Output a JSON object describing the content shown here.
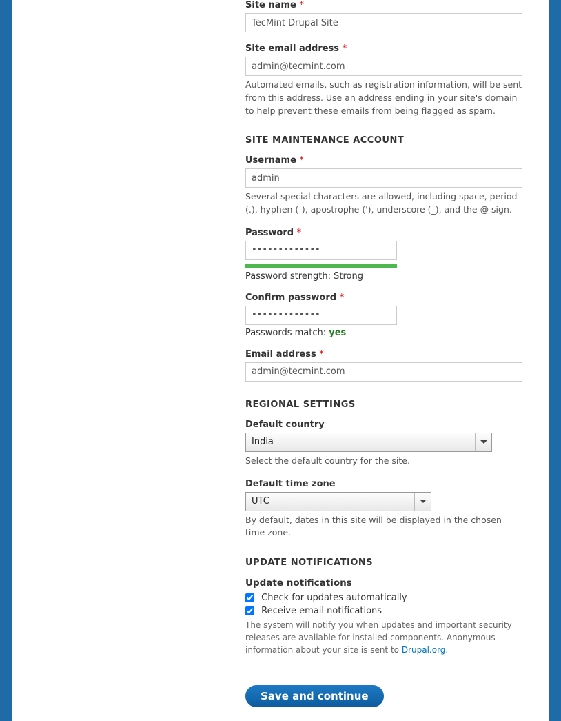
{
  "site_info": {
    "site_name_label": "Site name",
    "site_name_value": "TecMint Drupal Site",
    "site_email_label": "Site email address",
    "site_email_value": "admin@tecmint.com",
    "site_email_desc": "Automated emails, such as registration information, will be sent from this address. Use an address ending in your site's domain to help prevent these emails from being flagged as spam."
  },
  "maintenance": {
    "legend": "SITE MAINTENANCE ACCOUNT",
    "username_label": "Username",
    "username_value": "admin",
    "username_desc": "Several special characters are allowed, including space, period (.), hyphen (-), apostrophe ('), underscore (_), and the @ sign.",
    "password_label": "Password",
    "password_value": "•••••••••••••",
    "strength_label": "Password strength: ",
    "strength_value": "Strong",
    "confirm_label": "Confirm password",
    "confirm_value": "•••••••••••••",
    "match_label": "Passwords match: ",
    "match_value": "yes",
    "email_label": "Email address",
    "email_value": "admin@tecmint.com"
  },
  "regional": {
    "legend": "REGIONAL SETTINGS",
    "country_label": "Default country",
    "country_value": "India",
    "country_desc": "Select the default country for the site.",
    "tz_label": "Default time zone",
    "tz_value": "UTC",
    "tz_desc": "By default, dates in this site will be displayed in the chosen time zone."
  },
  "updates": {
    "legend": "UPDATE NOTIFICATIONS",
    "heading": "Update notifications",
    "check_label": "Check for updates automatically",
    "email_label": "Receive email notifications",
    "desc_pre": "The system will notify you when updates and important security releases are available for installed components. Anonymous information about your site is sent to ",
    "link_text": "Drupal.org",
    "desc_post": "."
  },
  "submit_label": "Save and continue"
}
